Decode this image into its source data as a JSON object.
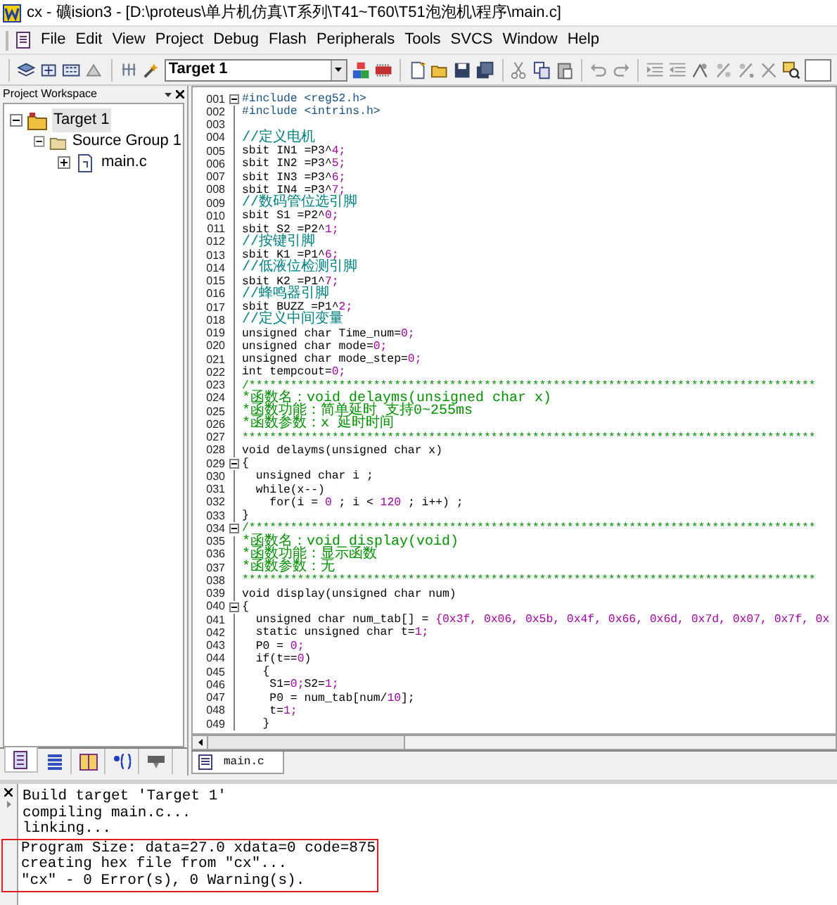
{
  "window": {
    "title": "cx  - 礦ision3 - [D:\\proteus\\单片机仿真\\T系列\\T41~T60\\T51泡泡机\\程序\\main.c]"
  },
  "menu": [
    "File",
    "Edit",
    "View",
    "Project",
    "Debug",
    "Flash",
    "Peripherals",
    "Tools",
    "SVCS",
    "Window",
    "Help"
  ],
  "toolbar": {
    "target_select": "Target 1"
  },
  "workspace": {
    "title": "Project Workspace",
    "tree": [
      {
        "label": "Target 1",
        "kind": "target",
        "expanded": true,
        "selected": true,
        "children": [
          {
            "label": "Source Group 1",
            "kind": "group",
            "expanded": true,
            "selected": false,
            "children": [
              {
                "label": "main.c",
                "kind": "file",
                "expanded": false,
                "selected": false
              }
            ]
          }
        ]
      }
    ],
    "tabs": [
      {
        "kind": "files",
        "selected": true
      },
      {
        "kind": "regs",
        "selected": false
      },
      {
        "kind": "books",
        "selected": false
      },
      {
        "kind": "functions",
        "selected": false
      },
      {
        "kind": "templates",
        "selected": false
      }
    ]
  },
  "editor": {
    "tab": "main.c",
    "lines": [
      {
        "number": "001",
        "fold": true,
        "segments": [
          {
            "kind": "directive",
            "text": "#include <reg52.h>"
          }
        ]
      },
      {
        "number": "002",
        "fold": false,
        "segments": [
          {
            "kind": "directive",
            "text": "#include <intrins.h>"
          }
        ]
      },
      {
        "number": "003",
        "fold": false
      },
      {
        "number": "004",
        "fold": false,
        "segments": [
          {
            "kind": "comment",
            "text": "//定义电机"
          }
        ]
      },
      {
        "number": "005",
        "fold": false,
        "segments": [
          {
            "kind": "code",
            "text": "sbit IN1 =P3^"
          },
          {
            "kind": "number",
            "text": "4;"
          }
        ]
      },
      {
        "number": "006",
        "fold": false,
        "segments": [
          {
            "kind": "code",
            "text": "sbit IN2 =P3^"
          },
          {
            "kind": "number",
            "text": "5;"
          }
        ]
      },
      {
        "number": "007",
        "fold": false,
        "segments": [
          {
            "kind": "code",
            "text": "sbit IN3 =P3^"
          },
          {
            "kind": "number",
            "text": "6;"
          }
        ]
      },
      {
        "number": "008",
        "fold": false,
        "segments": [
          {
            "kind": "code",
            "text": "sbit IN4 =P3^"
          },
          {
            "kind": "number",
            "text": "7;"
          }
        ]
      },
      {
        "number": "009",
        "fold": false,
        "segments": [
          {
            "kind": "comment",
            "text": "//数码管位选引脚"
          }
        ]
      },
      {
        "number": "010",
        "fold": false,
        "segments": [
          {
            "kind": "code",
            "text": "sbit S1 =P2^"
          },
          {
            "kind": "number",
            "text": "0;"
          }
        ]
      },
      {
        "number": "011",
        "fold": false,
        "segments": [
          {
            "kind": "code",
            "text": "sbit S2 =P2^"
          },
          {
            "kind": "number",
            "text": "1;"
          }
        ]
      },
      {
        "number": "012",
        "fold": false,
        "segments": [
          {
            "kind": "comment",
            "text": "//按键引脚"
          }
        ]
      },
      {
        "number": "013",
        "fold": false,
        "segments": [
          {
            "kind": "code",
            "text": "sbit K1 =P1^"
          },
          {
            "kind": "number",
            "text": "6;"
          }
        ]
      },
      {
        "number": "014",
        "fold": false,
        "segments": [
          {
            "kind": "comment",
            "text": "//低液位检测引脚"
          }
        ]
      },
      {
        "number": "015",
        "fold": false,
        "segments": [
          {
            "kind": "code",
            "text": "sbit K2 =P1^"
          },
          {
            "kind": "number",
            "text": "7;"
          }
        ]
      },
      {
        "number": "016",
        "fold": false,
        "segments": [
          {
            "kind": "comment",
            "text": "//蜂鸣器引脚"
          }
        ]
      },
      {
        "number": "017",
        "fold": false,
        "segments": [
          {
            "kind": "code",
            "text": "sbit BUZZ =P1^"
          },
          {
            "kind": "number",
            "text": "2;"
          }
        ]
      },
      {
        "number": "018",
        "fold": false,
        "segments": [
          {
            "kind": "comment",
            "text": "//定义中间变量"
          }
        ]
      },
      {
        "number": "019",
        "fold": false,
        "segments": [
          {
            "kind": "code",
            "text": "unsigned char Time_num="
          },
          {
            "kind": "number",
            "text": "0;"
          }
        ]
      },
      {
        "number": "020",
        "fold": false,
        "segments": [
          {
            "kind": "code",
            "text": "unsigned char mode="
          },
          {
            "kind": "number",
            "text": "0;"
          }
        ]
      },
      {
        "number": "021",
        "fold": false,
        "segments": [
          {
            "kind": "code",
            "text": "unsigned char mode_step="
          },
          {
            "kind": "number",
            "text": "0;"
          }
        ]
      },
      {
        "number": "022",
        "fold": false,
        "segments": [
          {
            "kind": "code",
            "text": "int tempcout="
          },
          {
            "kind": "number",
            "text": "0;"
          }
        ]
      },
      {
        "number": "023",
        "fold": false,
        "segments": [
          {
            "kind": "rule",
            "text": "/**********************************************************************************"
          }
        ]
      },
      {
        "number": "024",
        "fold": false,
        "segments": [
          {
            "kind": "doc",
            "text": "*函数名：void delayms(unsigned char x)"
          }
        ]
      },
      {
        "number": "025",
        "fold": false,
        "segments": [
          {
            "kind": "doc",
            "text": "*函数功能：简单延时 支持0~255ms"
          }
        ]
      },
      {
        "number": "026",
        "fold": false,
        "segments": [
          {
            "kind": "doc",
            "text": "*函数参数：x 延时时间"
          }
        ]
      },
      {
        "number": "027",
        "fold": false,
        "segments": [
          {
            "kind": "rule",
            "text": "***********************************************************************************"
          }
        ]
      },
      {
        "number": "028",
        "fold": false,
        "segments": [
          {
            "kind": "code",
            "text": "void delayms(unsigned char x)"
          }
        ]
      },
      {
        "number": "029",
        "fold": true,
        "segments": [
          {
            "kind": "code",
            "text": "{"
          }
        ]
      },
      {
        "number": "030",
        "fold": false,
        "segments": [
          {
            "kind": "code",
            "text": "  unsigned char i ;"
          }
        ]
      },
      {
        "number": "031",
        "fold": false,
        "segments": [
          {
            "kind": "code",
            "text": "  while(x--)"
          }
        ]
      },
      {
        "number": "032",
        "fold": false,
        "segments": [
          {
            "kind": "code",
            "text": "    for(i = "
          },
          {
            "kind": "number",
            "text": "0"
          },
          {
            "kind": "code",
            "text": " ; i < "
          },
          {
            "kind": "number",
            "text": "120"
          },
          {
            "kind": "code",
            "text": " ; i++) ;"
          }
        ]
      },
      {
        "number": "033",
        "fold": false,
        "segments": [
          {
            "kind": "code",
            "text": "}"
          }
        ]
      },
      {
        "number": "034",
        "fold": true,
        "segments": [
          {
            "kind": "rule",
            "text": "/**********************************************************************************"
          }
        ]
      },
      {
        "number": "035",
        "fold": false,
        "segments": [
          {
            "kind": "doc",
            "text": "*函数名：void display(void)"
          }
        ]
      },
      {
        "number": "036",
        "fold": false,
        "segments": [
          {
            "kind": "doc",
            "text": "*函数功能：显示函数"
          }
        ]
      },
      {
        "number": "037",
        "fold": false,
        "segments": [
          {
            "kind": "doc",
            "text": "*函数参数：无"
          }
        ]
      },
      {
        "number": "038",
        "fold": false,
        "segments": [
          {
            "kind": "rule",
            "text": "***********************************************************************************"
          }
        ]
      },
      {
        "number": "039",
        "fold": false,
        "segments": [
          {
            "kind": "code",
            "text": "void display(unsigned char num)"
          }
        ]
      },
      {
        "number": "040",
        "fold": true,
        "segments": [
          {
            "kind": "code",
            "text": "{"
          }
        ]
      },
      {
        "number": "041",
        "fold": false,
        "segments": [
          {
            "kind": "code",
            "text": "  unsigned char num_tab[] = "
          },
          {
            "kind": "number",
            "text": "{0x3f, 0x06, 0x5b, 0x4f, 0x66, 0x6d, 0x7d, 0x07, 0x7f, 0x"
          }
        ]
      },
      {
        "number": "042",
        "fold": false,
        "segments": [
          {
            "kind": "code",
            "text": "  static unsigned char t="
          },
          {
            "kind": "number",
            "text": "1;"
          }
        ]
      },
      {
        "number": "043",
        "fold": false,
        "segments": [
          {
            "kind": "code",
            "text": "  P0 = "
          },
          {
            "kind": "number",
            "text": "0;"
          }
        ]
      },
      {
        "number": "044",
        "fold": false,
        "segments": [
          {
            "kind": "code",
            "text": "  if(t=="
          },
          {
            "kind": "number",
            "text": "0"
          },
          {
            "kind": "code",
            "text": ")"
          }
        ]
      },
      {
        "number": "045",
        "fold": false,
        "segments": [
          {
            "kind": "code",
            "text": "   {"
          }
        ]
      },
      {
        "number": "046",
        "fold": false,
        "segments": [
          {
            "kind": "code",
            "text": "    S1="
          },
          {
            "kind": "number",
            "text": "0;"
          },
          {
            "kind": "code",
            "text": "S2="
          },
          {
            "kind": "number",
            "text": "1;"
          }
        ]
      },
      {
        "number": "047",
        "fold": false,
        "segments": [
          {
            "kind": "code",
            "text": "    P0 = num_tab[num/"
          },
          {
            "kind": "number",
            "text": "10"
          },
          {
            "kind": "code",
            "text": "];"
          }
        ]
      },
      {
        "number": "048",
        "fold": false,
        "segments": [
          {
            "kind": "code",
            "text": "    t="
          },
          {
            "kind": "number",
            "text": "1;"
          }
        ]
      },
      {
        "number": "049",
        "fold": false,
        "segments": [
          {
            "kind": "code",
            "text": "   }"
          }
        ]
      }
    ]
  },
  "output": {
    "lines": [
      {
        "text": "Build target 'Target 1'",
        "highlighted": false
      },
      {
        "text": "compiling main.c...",
        "highlighted": false
      },
      {
        "text": "linking...",
        "highlighted": false
      },
      {
        "text": "Program Size: data=27.0 xdata=0 code=875",
        "highlighted": true
      },
      {
        "text": "creating hex file from \"cx\"...",
        "highlighted": true
      },
      {
        "text": "\"cx\" - 0 Error(s), 0 Warning(s).",
        "highlighted": true
      }
    ]
  }
}
